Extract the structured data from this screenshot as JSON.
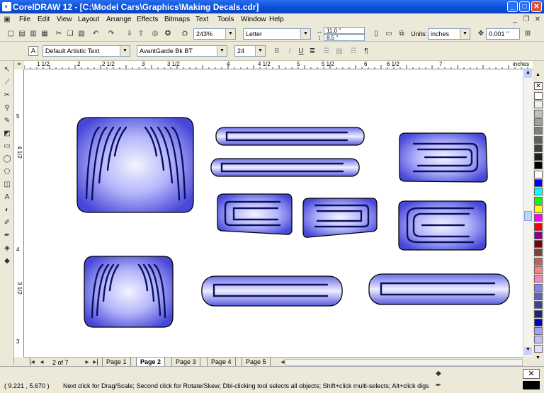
{
  "window": {
    "title": "CorelDRAW 12 - [C:\\Model Cars\\Graphics\\Making Decals.cdr]",
    "min": "_",
    "max": "□",
    "close": "✕"
  },
  "menu": [
    "File",
    "Edit",
    "View",
    "Layout",
    "Arrange",
    "Effects",
    "Bitmaps",
    "Text",
    "Tools",
    "Window",
    "Help"
  ],
  "standard": {
    "zoom": "243%",
    "paper": "Letter",
    "width": "11.0 \"",
    "height": "8.5 \"",
    "units_label": "Units:",
    "units": "inches",
    "nudge": "0.001 \""
  },
  "text_props": {
    "style": "Default Artistic Text",
    "font": "AvantGarde Bk BT",
    "size": "24"
  },
  "ruler": {
    "h_ticks": [
      "1 1/2",
      "2",
      "2 1/2",
      "3",
      "3 1/2",
      "4",
      "4 1/2",
      "5",
      "5 1/2",
      "6",
      "6 1/2",
      "7"
    ],
    "h_unit": "inches",
    "v_ticks": [
      "5",
      "4 1/2",
      "4",
      "3 1/2",
      "3"
    ]
  },
  "pages": {
    "count": "2 of 7",
    "tabs": [
      "Page 1",
      "Page 2",
      "Page 3",
      "Page 4",
      "Page 5"
    ],
    "active": 1
  },
  "status": {
    "coords": "( 9.221 , 5.670 )",
    "hint": "Next click for Drag/Scale; Second click for Rotate/Skew; Dbl-clicking tool selects all objects; Shift+click multi-selects; Alt+click digs"
  },
  "palette": [
    "#ffffff",
    "#f0f0f0",
    "#c0c0c0",
    "#a0a0a0",
    "#808080",
    "#606060",
    "#404040",
    "#202020",
    "#000000",
    "#ffffff",
    "#0000ff",
    "#00ffff",
    "#00ff00",
    "#ffff00",
    "#ff00ff",
    "#ff0000",
    "#8b008b",
    "#800000",
    "#804040",
    "#c06060",
    "#ff8080",
    "#ff80c0",
    "#8080ff",
    "#6060c0",
    "#4040a0",
    "#202080",
    "#0000c0",
    "#a0a0ff",
    "#c0c0ff",
    "#e0e0ff"
  ],
  "colors": {
    "titlebar": "#0a4fd8",
    "shape_fill": "#8a8cf0",
    "shape_stroke": "#000000",
    "stripe": "#0a0f60"
  }
}
